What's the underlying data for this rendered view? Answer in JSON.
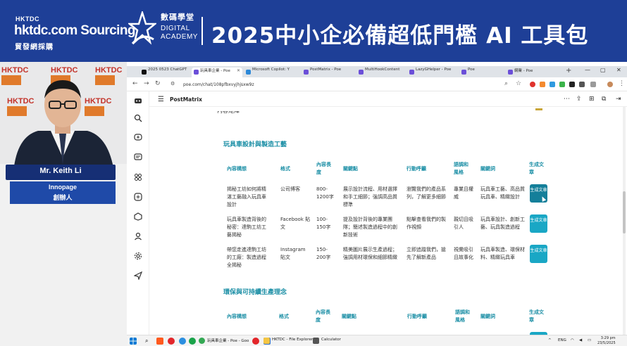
{
  "banner": {
    "hktdc_small": "HKTDC",
    "sourcing": "hktdc.com Sourcing",
    "sourcing_chinese": "貿發網採購",
    "academy_chinese": "數碼學堂",
    "academy_en_1": "DIGITAL",
    "academy_en_2": "ACADEMY",
    "title": "2025中小企必備超低門檻 AI 工具包"
  },
  "speaker": {
    "name": "Mr. Keith Li",
    "company": "Innopage",
    "role": "創辦人",
    "wall_logo": "HKTDC"
  },
  "browser": {
    "tabs": [
      {
        "label": "2025 0523 ChatGPT",
        "color": "#111111"
      },
      {
        "label": "玩具車企業 - Poe",
        "color": "#6b4fd8"
      },
      {
        "label": "Microsoft Copilot: Y",
        "color": "#2b88d8"
      },
      {
        "label": "PostMatrix - Poe",
        "color": "#6b4fd8"
      },
      {
        "label": "MultiHookContent",
        "color": "#6b4fd8"
      },
      {
        "label": "LazyGHelper - Poe",
        "color": "#6b4fd8"
      },
      {
        "label": "Poe",
        "color": "#6b4fd8"
      },
      {
        "label": "網業 - Poe",
        "color": "#6b4fd8"
      }
    ],
    "url": "poe.com/chat/108pfbxvyjhjsxw9z",
    "window_min": "—",
    "window_max": "▢",
    "window_close": "✕"
  },
  "poe": {
    "bot_name": "PostMatrix",
    "cut_heading": "內容矩陣"
  },
  "sections": [
    {
      "title": "玩具車設計與製造工藝",
      "headers": [
        "內容構想",
        "格式",
        "內容長度",
        "關鍵點",
        "行動呼籲",
        "語調和風格",
        "關鍵詞",
        "生成文章"
      ],
      "rows": [
        {
          "idea": "揭秘工坊如何將精湛工藝融入玩具車設計",
          "format": "公司博客",
          "length": "800-1200字",
          "key_points": "展示設計流程、用材選擇和手工細節；強調高品質標準",
          "cta": "瀏覽我們的產品系列，了解更多細節",
          "tone": "專業且權威",
          "keywords": "玩具車工藝、高品質玩具車、精緻設計",
          "button": "生成文章"
        },
        {
          "idea": "玩具車製造背後的秘密：達駒工坊工藝揭秘",
          "format": "Facebook 貼文",
          "length": "100-150字",
          "key_points": "提及設計背後的專業團隊；簡述製造過程中的創新技術",
          "cta": "點擊查看我們的製作視頻",
          "tone": "親切且吸引人",
          "keywords": "玩具車設計、創新工藝、玩具製造過程",
          "button": "生成文章"
        },
        {
          "idea": "帶您走進達駒工坊的工廠：製造過程全揭秘",
          "format": "Instagram 貼文",
          "length": "150-200字",
          "key_points": "精美圖片展示生產過程；強調用材環保和細節精緻",
          "cta": "立即追蹤我們，搶先了解新產品",
          "tone": "視覺吸引且故事化",
          "keywords": "玩具車製造、環保材料、精緻玩具車",
          "button": "生成文章"
        }
      ]
    },
    {
      "title": "環保與可持續生產理念",
      "headers": [
        "內容構想",
        "格式",
        "內容長度",
        "關鍵點",
        "行動呼籲",
        "語調和風格",
        "關鍵詞",
        "生成文章"
      ],
      "rows": []
    }
  ],
  "taskbar": {
    "apps": [
      {
        "label": "玩具車企業 - Poe - Goo",
        "color": "#34a853"
      },
      {
        "label": "HKTDC - File Explorer",
        "color": "#f4c542"
      },
      {
        "label": "Calculator",
        "color": "#555555"
      }
    ],
    "lang": "ENG",
    "time": "3:29 pm",
    "date": "23/5/2025"
  }
}
